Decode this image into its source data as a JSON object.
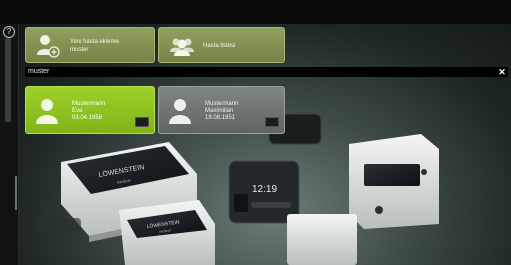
{
  "sidebar": {
    "help_glyph": "?"
  },
  "tiles": [
    {
      "label_line1": "Yeni hasta ekleme",
      "label_line2": "muster",
      "icon": "add-user-icon"
    },
    {
      "label_line1": "Hasta listesi",
      "icon": "users-icon"
    }
  ],
  "search": {
    "value": "muster",
    "clear_glyph": "✕"
  },
  "patients": [
    {
      "last": "Mustermann",
      "first": "Eva",
      "dob": "03.04.1958",
      "selected": true
    },
    {
      "last": "Mustermann",
      "first": "Maximilian",
      "dob": "19.08.1951",
      "selected": false
    }
  ],
  "background": {
    "brand_a": "LÖWENSTEIN",
    "brand_a_sub": "medical",
    "clock": "12:19",
    "brand_b": "LÖWENSTEIN",
    "brand_b_sub": "medical"
  },
  "colors": {
    "tile_green": "#8b9c5d",
    "card_selected": "#94c823",
    "card_default": "#6f7673"
  }
}
